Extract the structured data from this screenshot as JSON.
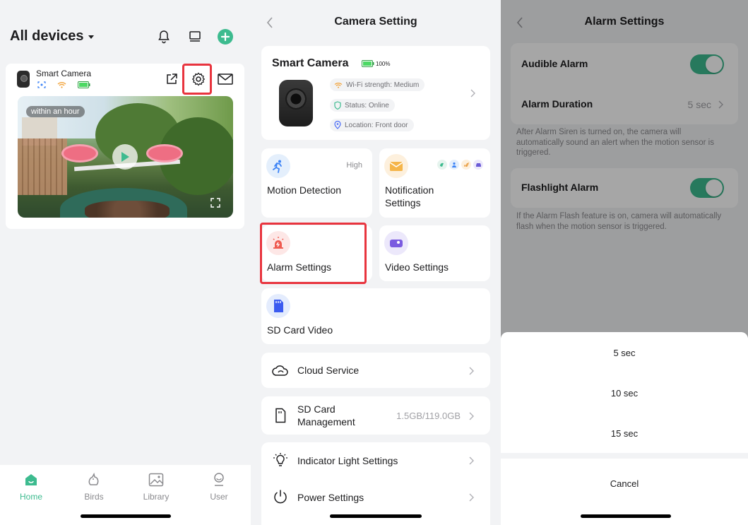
{
  "colors": {
    "accent": "#3dbb8f",
    "highlight": "#e8343e",
    "background": "#f2f3f5"
  },
  "home": {
    "title": "All devices",
    "icons": [
      "bell-icon",
      "device-list-icon",
      "add-icon"
    ],
    "device": {
      "name": "Smart Camera",
      "icons": [
        "motion-icon",
        "wifi-icon",
        "battery-icon",
        "share-icon",
        "gear-icon",
        "mail-icon"
      ],
      "video_time": "within an hour"
    },
    "tabs": [
      {
        "label": "Home",
        "icon": "home-icon",
        "active": true
      },
      {
        "label": "Birds",
        "icon": "bird-icon",
        "active": false
      },
      {
        "label": "Library",
        "icon": "library-icon",
        "active": false
      },
      {
        "label": "User",
        "icon": "user-icon",
        "active": false
      }
    ]
  },
  "camera_setting": {
    "title": "Camera Setting",
    "camera": {
      "name": "Smart Camera",
      "battery": "100%",
      "wifi": "Wi-Fi strength: Medium",
      "status": "Status: Online",
      "location": "Location: Front door"
    },
    "tiles": {
      "motion": {
        "label": "Motion Detection",
        "value": "High"
      },
      "notification": {
        "label_line1": "Notification",
        "label_line2": "Settings"
      },
      "alarm": {
        "label": "Alarm Settings"
      },
      "video": {
        "label": "Video Settings"
      },
      "sd_video": {
        "label": "SD Card Video"
      }
    },
    "rows": {
      "cloud": {
        "label": "Cloud Service"
      },
      "sd_mgmt": {
        "label_line1": "SD Card",
        "label_line2": "Management",
        "value": "1.5GB/119.0GB"
      },
      "indicator": {
        "label": "Indicator Light Settings"
      },
      "power": {
        "label": "Power Settings"
      }
    }
  },
  "alarm_settings": {
    "title": "Alarm Settings",
    "audible": {
      "label": "Audible Alarm",
      "enabled": true
    },
    "duration": {
      "label": "Alarm Duration",
      "value": "5 sec"
    },
    "duration_desc": "After Alarm Siren is turned on, the camera will automatically sound an alert when the motion sensor is triggered.",
    "flashlight": {
      "label": "Flashlight Alarm",
      "enabled": true
    },
    "flashlight_desc": "If the Alarm Flash feature is on, camera will automatically flash when the motion sensor is triggered.",
    "sheet": {
      "options": [
        "5 sec",
        "10 sec",
        "15 sec"
      ],
      "cancel": "Cancel"
    }
  }
}
